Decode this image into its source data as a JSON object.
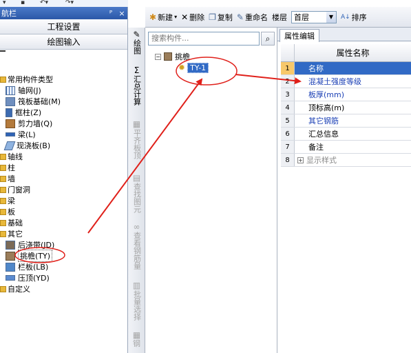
{
  "nav": {
    "title": "航栏",
    "pin": "ᴾ",
    "close": "×",
    "btn_project": "工程设置",
    "btn_draw": "绘图输入"
  },
  "tree": {
    "common": "常用构件类型",
    "grid": "轴网(J)",
    "raft": "筏板基础(M)",
    "frame_col": "框柱(Z)",
    "shear_wall": "剪力墙(Q)",
    "beam": "梁(L)",
    "cast_slab": "现浇板(B)",
    "axis": "轴线",
    "column": "柱",
    "wall": "墙",
    "door_window": "门窗洞",
    "beam2": "梁",
    "slab": "板",
    "foundation": "基础",
    "other": "其它",
    "post_strip": "后浇带(JD)",
    "eave": "挑檐(TY)",
    "railing": "栏板(LB)",
    "coping": "压顶(YD)",
    "custom": "自定义"
  },
  "vtool": {
    "draw": "绘图",
    "sum": "汇总计算",
    "flush": "平齐板顶",
    "find": "查找图元",
    "view_rebar": "查看钢筋量",
    "batch": "批量选择",
    "rebar3d": "钢"
  },
  "toolbar": {
    "new": "新建",
    "delete": "删除",
    "copy": "复制",
    "rename": "重命名",
    "floor_label": "楼层",
    "floor_value": "首层",
    "sort": "排序"
  },
  "comp": {
    "search_placeholder": "搜索构件...",
    "root": "挑檐",
    "item": "TY-1"
  },
  "props": {
    "tab": "属性编辑",
    "header": "属性名称",
    "rows": [
      {
        "n": "1",
        "name": "名称"
      },
      {
        "n": "2",
        "name": "混凝土强度等级"
      },
      {
        "n": "3",
        "name": "板厚(mm)"
      },
      {
        "n": "4",
        "name": "顶标高(m)"
      },
      {
        "n": "5",
        "name": "其它钢筋"
      },
      {
        "n": "6",
        "name": "汇总信息"
      },
      {
        "n": "7",
        "name": "备注"
      },
      {
        "n": "8",
        "name": "显示样式"
      }
    ]
  },
  "colors": {
    "annotation": "#e0201a",
    "selection": "#316ac5"
  }
}
